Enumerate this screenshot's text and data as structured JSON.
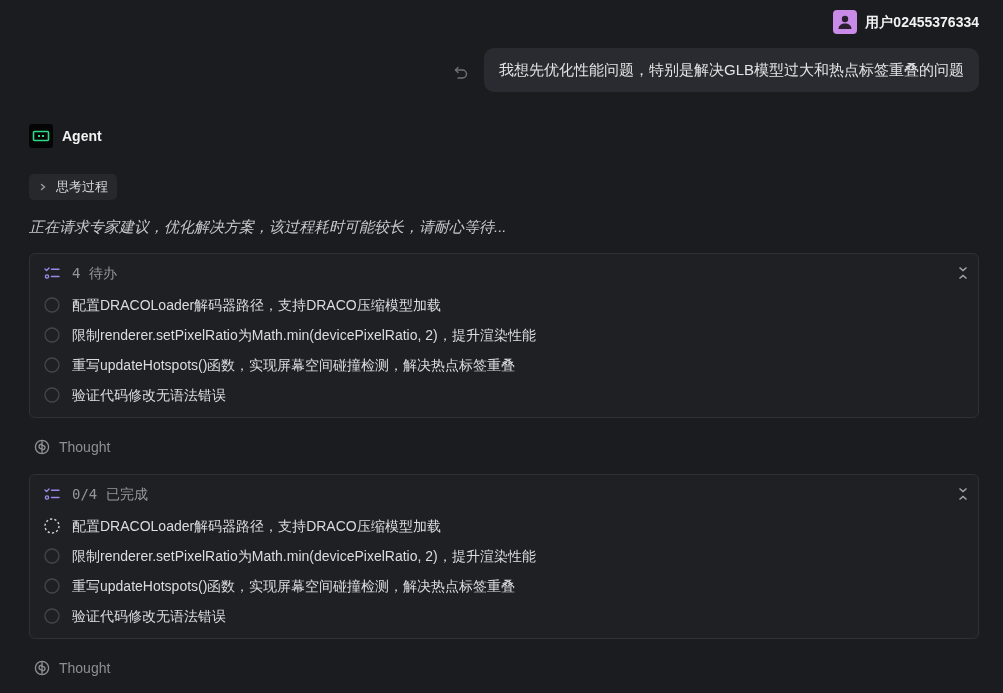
{
  "user": {
    "name": "用户02455376334"
  },
  "user_message": {
    "text": "我想先优化性能问题，特别是解决GLB模型过大和热点标签重叠的问题"
  },
  "agent": {
    "name": "Agent"
  },
  "thinking_toggle": {
    "label": "思考过程",
    "expanded": false
  },
  "status_message": "正在请求专家建议，优化解决方案，该过程耗时可能较长，请耐心等待...",
  "blocks": [
    {
      "kind": "todo",
      "header": "4 待办",
      "expanded": true,
      "items": [
        {
          "text": "配置DRACOLoader解码器路径，支持DRACO压缩模型加载",
          "in_progress": false
        },
        {
          "text": "限制renderer.setPixelRatio为Math.min(devicePixelRatio, 2)，提升渲染性能",
          "in_progress": false
        },
        {
          "text": "重写updateHotspots()函数，实现屏幕空间碰撞检测，解决热点标签重叠",
          "in_progress": false
        },
        {
          "text": "验证代码修改无语法错误",
          "in_progress": false
        }
      ]
    },
    {
      "kind": "thought",
      "label": "Thought"
    },
    {
      "kind": "todo",
      "header": "0/4 已完成",
      "expanded": true,
      "items": [
        {
          "text": "配置DRACOLoader解码器路径，支持DRACO压缩模型加载",
          "in_progress": true
        },
        {
          "text": "限制renderer.setPixelRatio为Math.min(devicePixelRatio, 2)，提升渲染性能",
          "in_progress": false
        },
        {
          "text": "重写updateHotspots()函数，实现屏幕空间碰撞检测，解决热点标签重叠",
          "in_progress": false
        },
        {
          "text": "验证代码修改无语法错误",
          "in_progress": false
        }
      ]
    },
    {
      "kind": "thought",
      "label": "Thought"
    }
  ]
}
